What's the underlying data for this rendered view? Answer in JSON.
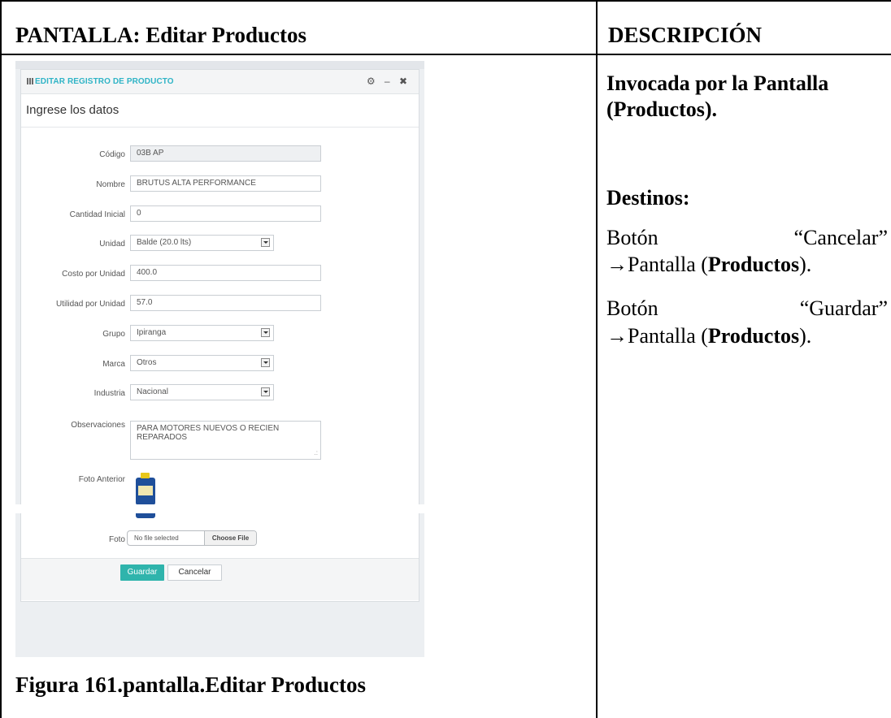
{
  "table": {
    "left_header": "PANTALLA: Editar Productos",
    "right_header": "DESCRIPCIÓN",
    "caption": "Figura 161.pantalla.Editar Productos"
  },
  "description": {
    "invoked_line1": "Invocada por la Pantalla",
    "invoked_line2": "(Productos).",
    "destinos_heading": "Destinos:",
    "cancel": {
      "word": "Botón",
      "quoted": "“Cancelar”",
      "arrow": "→",
      "prefix": "Pantalla (",
      "bold": "Productos",
      "suffix": ")."
    },
    "save": {
      "word": "Botón",
      "quoted": "“Guardar”",
      "arrow": "→",
      "prefix": "Pantalla (",
      "bold": "Productos",
      "suffix": ")."
    }
  },
  "screenshot": {
    "panel_title": "EDITAR REGISTRO DE PRODUCTO",
    "title_icon": "calendar-icon",
    "tool_icons": [
      "gear-icon",
      "minus-icon",
      "close-icon"
    ],
    "tool_glyphs": "⚙ – ✖",
    "subtitle": "Ingrese los datos",
    "accent_color": "#2fb4c6",
    "fields": {
      "codigo": {
        "label": "Código",
        "value": "03B AP"
      },
      "nombre": {
        "label": "Nombre",
        "value": "BRUTUS ALTA PERFORMANCE"
      },
      "cantidad": {
        "label": "Cantidad Inicial",
        "value": "0"
      },
      "unidad": {
        "label": "Unidad",
        "value": "Balde (20.0 lts)"
      },
      "costo": {
        "label": "Costo por Unidad",
        "value": "400.0"
      },
      "utilidad": {
        "label": "Utilidad por Unidad",
        "value": "57.0"
      },
      "grupo": {
        "label": "Grupo",
        "value": "Ipiranga"
      },
      "marca": {
        "label": "Marca",
        "value": "Otros"
      },
      "industria": {
        "label": "Industria",
        "value": "Nacional"
      },
      "observaciones": {
        "label": "Observaciones",
        "value": "PARA MOTORES NUEVOS O RECIEN REPARADOS"
      },
      "foto_anterior": {
        "label": "Foto Anterior"
      },
      "foto": {
        "label": "Foto",
        "no_file": "No file selected",
        "choose": "Choose File"
      }
    },
    "buttons": {
      "save": "Guardar",
      "cancel": "Cancelar"
    },
    "save_color": "#2fb4ac"
  }
}
